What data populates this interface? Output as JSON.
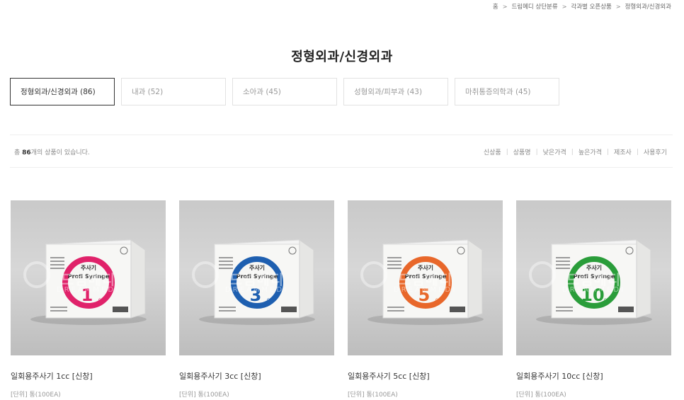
{
  "breadcrumb": [
    "홈",
    "드림메디 상단분류",
    "각과별 오픈상품",
    "정형외과/신경외과"
  ],
  "page_title": "정형외과/신경외과",
  "categories": [
    {
      "label": "정형외과/신경외과 (86)",
      "active": true
    },
    {
      "label": "내과 (52)",
      "active": false
    },
    {
      "label": "소아과 (45)",
      "active": false
    },
    {
      "label": "성형외과/피부과 (43)",
      "active": false
    },
    {
      "label": "마취통증의학과 (45)",
      "active": false
    }
  ],
  "count": {
    "prefix": "총 ",
    "number": "86",
    "suffix": "개의 상품이 있습니다."
  },
  "sort_options": [
    "신상품",
    "상품명",
    "낮은가격",
    "높은가격",
    "제조사",
    "사용후기"
  ],
  "watermark": {
    "main": "드림메디",
    "sub": "DREAMMEDI"
  },
  "products": [
    {
      "name": "일회용주사기 1cc [신창]",
      "unit": "[단위] 통(100EA)",
      "box_number": "1",
      "box_unit": "cc",
      "color": "#e0226a",
      "box_title": "주사기",
      "box_brand": "Profi Syringe"
    },
    {
      "name": "일회용주사기 3cc [신창]",
      "unit": "[단위] 통(100EA)",
      "box_number": "3",
      "box_unit": "cc",
      "color": "#1e5fb0",
      "box_title": "주사기",
      "box_brand": "Profi Syringe"
    },
    {
      "name": "일회용주사기 5cc [신창]",
      "unit": "[단위] 통(100EA)",
      "box_number": "5",
      "box_unit": "cc",
      "color": "#e8672a",
      "box_title": "주사기",
      "box_brand": "Profi Syringe"
    },
    {
      "name": "일회용주사기 10cc [신창]",
      "unit": "[단위] 통(100EA)",
      "box_number": "10",
      "box_unit": "cc",
      "color": "#2a9d3a",
      "box_title": "주사기",
      "box_brand": "Profi Syringe"
    }
  ]
}
